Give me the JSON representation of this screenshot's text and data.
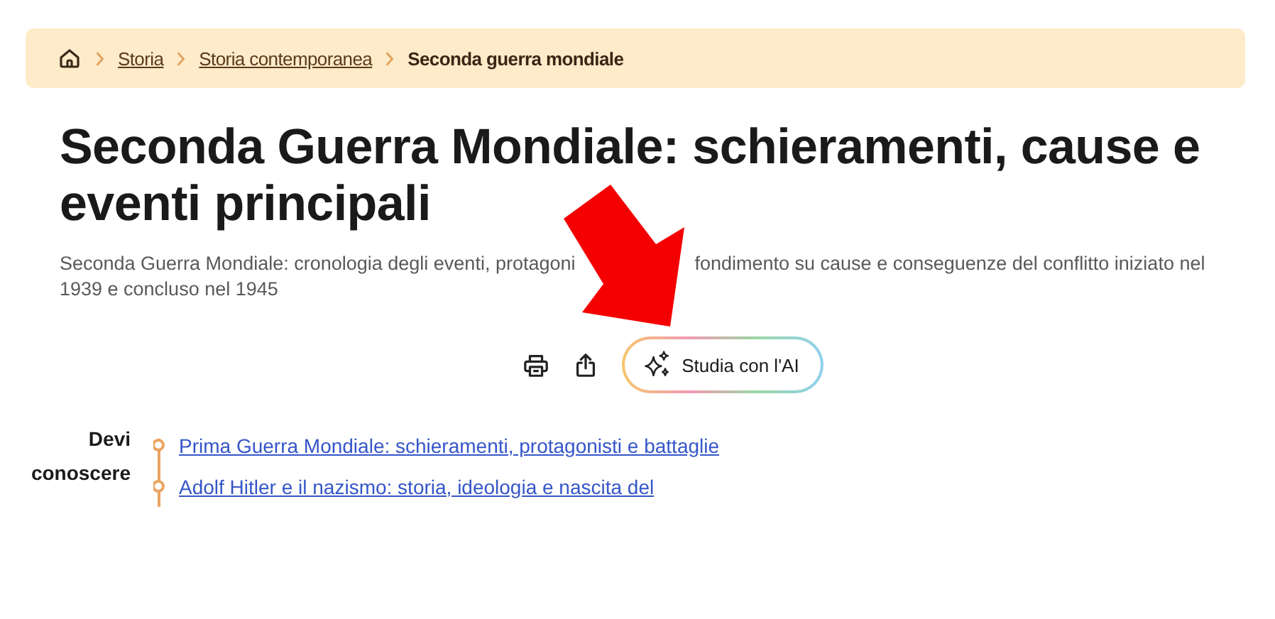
{
  "breadcrumb": {
    "items": [
      {
        "label": "Storia",
        "kind": "link"
      },
      {
        "label": "Storia contemporanea",
        "kind": "link"
      },
      {
        "label": "Seconda guerra mondiale",
        "kind": "current"
      }
    ]
  },
  "title": "Seconda Guerra Mondiale: schieramenti, cause e eventi principali",
  "description": {
    "line_1_parts": [
      "Seconda Guerra Mondiale: cronologia degli eventi, protagoni",
      "fondimento su cause e conseguenze del conflitto iniziato nel"
    ],
    "line_2": "1939 e concluso nel 1945"
  },
  "actions": {
    "ai_button": "Studia con l'AI"
  },
  "prerequisites": {
    "label": "Devi conoscere",
    "links": [
      "Prima Guerra Mondiale: schieramenti, protagonisti e battaglie",
      "Adolf Hitler e il nazismo: storia, ideologia e nascita del"
    ]
  }
}
